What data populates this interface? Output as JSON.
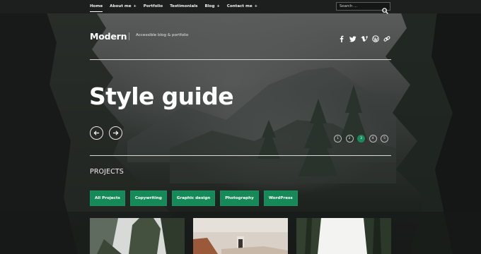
{
  "nav": {
    "items": [
      {
        "label": "Home",
        "caret": false,
        "active": true
      },
      {
        "label": "About me",
        "caret": true,
        "active": false
      },
      {
        "label": "Portfolio",
        "caret": false,
        "active": false
      },
      {
        "label": "Testimonials",
        "caret": false,
        "active": false
      },
      {
        "label": "Blog",
        "caret": true,
        "active": false
      },
      {
        "label": "Contact me",
        "caret": true,
        "active": false
      }
    ],
    "search_placeholder": "Search ..."
  },
  "header": {
    "site_title": "Modern",
    "tagline": "Accessible blog & portfolio",
    "social_icons": [
      "facebook-icon",
      "twitter-icon",
      "vimeo-icon",
      "wordpress-icon",
      "link-icon"
    ]
  },
  "hero": {
    "title": "Style guide",
    "slides": [
      "1",
      "2",
      "3",
      "4",
      "5"
    ],
    "active_slide": 3
  },
  "projects": {
    "heading": "PROJECTS",
    "filters": [
      "All Projects",
      "Copywriting",
      "Graphic design",
      "Photography",
      "WordPress"
    ]
  },
  "colors": {
    "accent": "#158a58",
    "nav_bg": "#1d1f1e",
    "text": "#ffffff"
  }
}
